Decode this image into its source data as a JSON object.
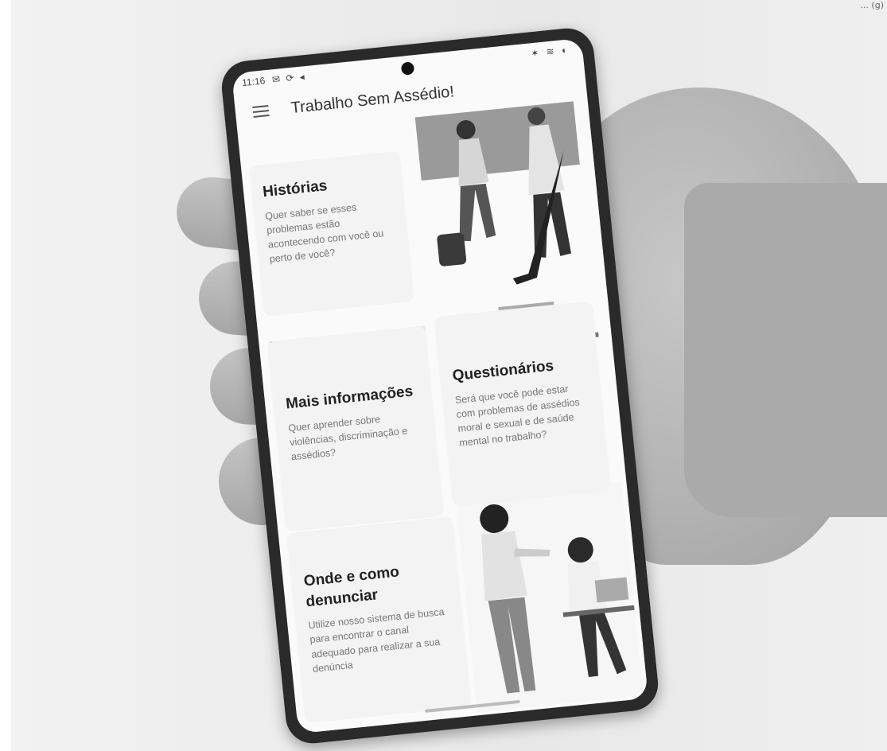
{
  "credit": "... (g)",
  "status_bar": {
    "time": "11:16",
    "left_icons": "✉ ⟳ ◂",
    "right_icons": "✶ ≋ ◐"
  },
  "app_bar": {
    "title": "Trabalho Sem Assédio!",
    "menu_icon": "hamburger-menu-icon"
  },
  "cards": [
    {
      "id": "historias",
      "title": "Histórias",
      "description": "Quer saber se esses problemas estão acontecendo com você ou perto de você?"
    },
    {
      "id": "mais-informacoes",
      "title": "Mais informações",
      "description": "Quer aprender sobre violências, discriminação e assédios?"
    },
    {
      "id": "questionarios",
      "title": "Questionários",
      "description": "Será que você pode estar com problemas de assédios moral e sexual e de saúde mental no trabalho?"
    },
    {
      "id": "onde-denunciar",
      "title": "Onde e como denunciar",
      "description": "Utilize nosso sistema de busca para encontrar o canal adequado para realizar a sua denúncia"
    }
  ]
}
